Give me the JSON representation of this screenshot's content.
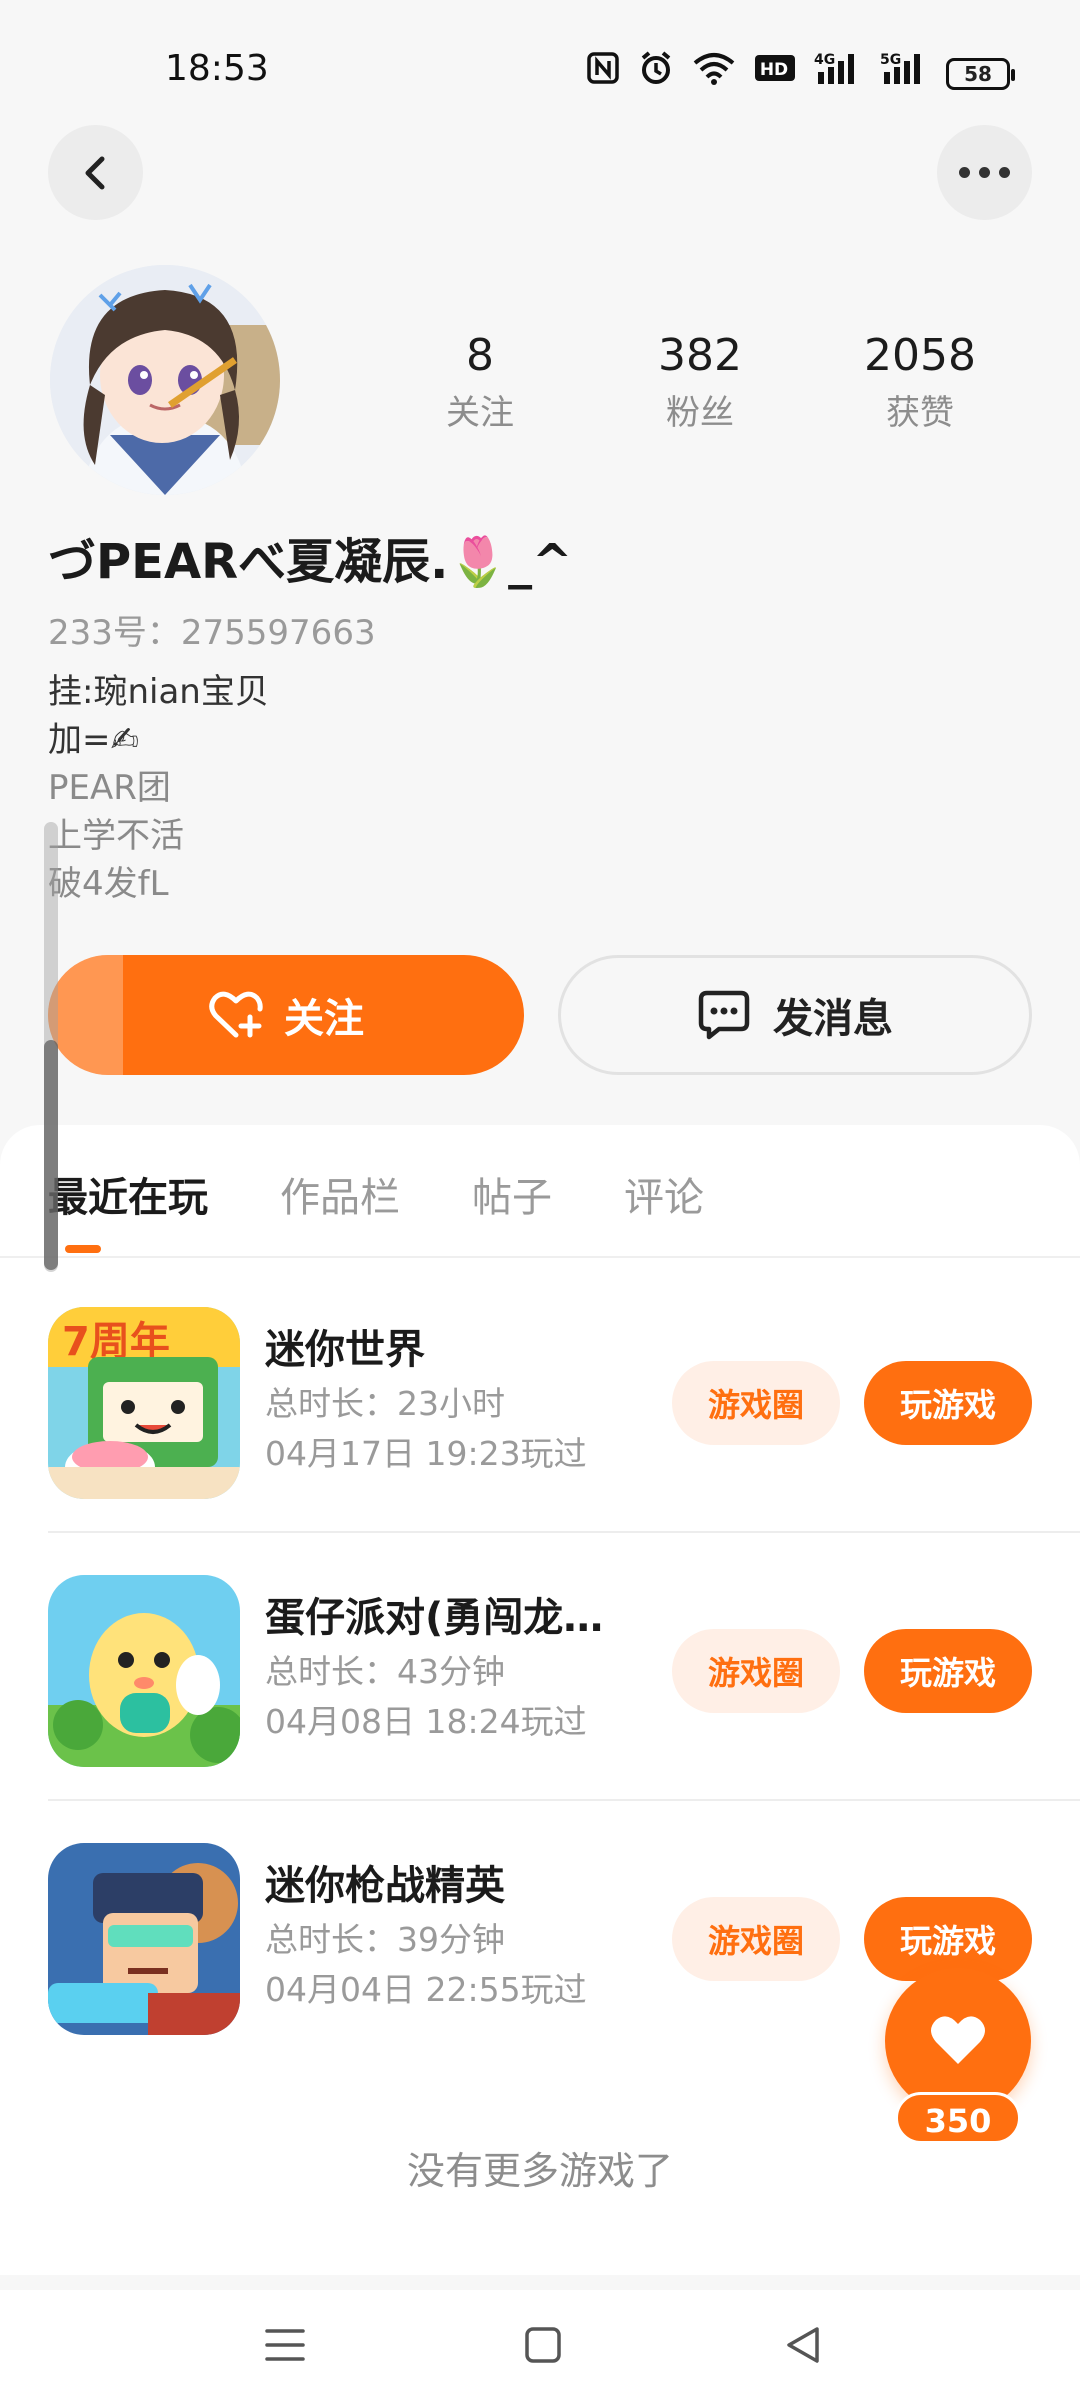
{
  "status_bar": {
    "time": "18:53",
    "icons": [
      "nfc-icon",
      "alarm-icon",
      "wifi-icon",
      "hd-icon",
      "4g-signal-icon",
      "5g-signal-icon"
    ],
    "battery": "58"
  },
  "profile": {
    "stats": [
      {
        "value": "8",
        "label": "关注"
      },
      {
        "value": "382",
        "label": "粉丝"
      },
      {
        "value": "2058",
        "label": "获赞"
      }
    ],
    "username": "づPEARべ夏凝辰.🌷_^",
    "uid": "233号：275597663",
    "bio": [
      "挂:琬nian宝贝",
      "加=✍",
      "PEAR团",
      "上学不活",
      "破4发fL"
    ]
  },
  "actions": {
    "follow_label": "关注",
    "message_label": "发消息"
  },
  "tabs": [
    "最近在玩",
    "作品栏",
    "帖子",
    "评论"
  ],
  "games": [
    {
      "name": "迷你世界",
      "duration": "总时长：23小时",
      "last_played": "04月17日  19:23玩过",
      "circle_label": "游戏圈",
      "play_label": "玩游戏"
    },
    {
      "name": "蛋仔派对(勇闯龙…",
      "duration": "总时长：43分钟",
      "last_played": "04月08日  18:24玩过",
      "circle_label": "游戏圈",
      "play_label": "玩游戏"
    },
    {
      "name": "迷你枪战精英",
      "duration": "总时长：39分钟",
      "last_played": "04月04日  22:55玩过",
      "circle_label": "游戏圈",
      "play_label": "玩游戏"
    }
  ],
  "list_end": "没有更多游戏了",
  "like_count": "350",
  "colors": {
    "accent": "#ff6f10",
    "accent_light": "#ffefe6",
    "background": "#f7f7f7"
  }
}
